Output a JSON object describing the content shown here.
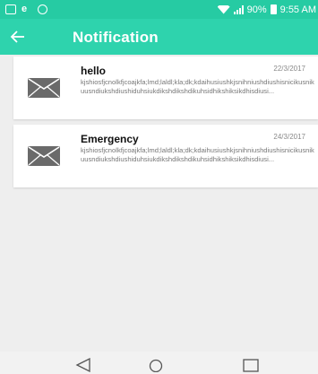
{
  "status_bar": {
    "battery_text": "90%",
    "time": "9:55 AM",
    "bar_color": "#26cba3",
    "icons": [
      "image-icon",
      "e-icon",
      "check-circle-icon",
      "wifi-icon",
      "signal-icon",
      "battery-icon"
    ]
  },
  "app_bar": {
    "title": "Notification",
    "back_icon": "arrow-left-icon",
    "color": "#2ed3ad"
  },
  "notifications": [
    {
      "title": "hello",
      "date": "22/3/2017",
      "body": "kjshiosfjcnolkfjcoajkfa;lmd;laldl;kla;dk;kdaihusiushkjsnihniushdiushisnicikusnikuusndiukshdiushiduhsiukdikshdikshdikuhsidhikshiksikdhisdiusi...",
      "icon": "envelope-icon"
    },
    {
      "title": "Emergency",
      "date": "24/3/2017",
      "body": "kjshiosfjcnolkfjcoajkfa;lmd;laldl;kla;dk;kdaihusiushkjsnihniushdiushisnicikusnikuusndiukshdiushiduhsiukdikshdikshdikuhsidhikshiksikdhisdiusi...",
      "icon": "envelope-icon"
    }
  ],
  "nav_bar": {
    "icons": [
      "nav-back-icon",
      "nav-home-icon",
      "nav-recents-icon"
    ]
  }
}
